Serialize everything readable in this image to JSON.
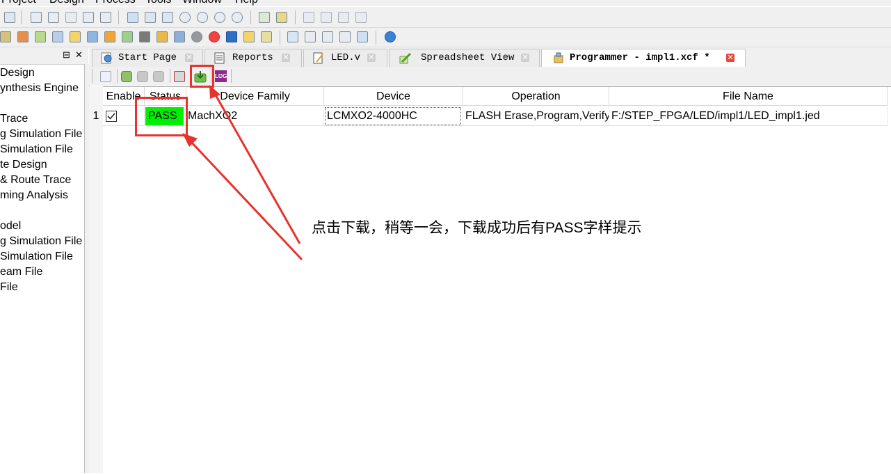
{
  "menubar": {
    "items": [
      "Project",
      "Design",
      "Process",
      "Tools",
      "Window",
      "Help"
    ]
  },
  "left_panel": {
    "items": [
      "Design",
      "ynthesis Engine",
      "Trace",
      "g Simulation File",
      "Simulation File",
      "te Design",
      "& Route Trace",
      "ming Analysis",
      "odel",
      "g Simulation File",
      "Simulation File",
      "eam File",
      "File"
    ],
    "pin_glyph": "⊟",
    "close_glyph": "✕"
  },
  "tabs": [
    {
      "label": "Start Page",
      "icon": "globe-page-icon",
      "active": false
    },
    {
      "label": "Reports",
      "icon": "report-icon",
      "active": false
    },
    {
      "label": "LED.v",
      "icon": "edit-document-icon",
      "active": false
    },
    {
      "label": "Spreadsheet View",
      "icon": "spreadsheet-pencil-icon",
      "active": false
    },
    {
      "label": "Programmer - impl1.xcf *",
      "icon": "programmer-chip-icon",
      "active": true
    }
  ],
  "tab_close_glyph": "✕",
  "programmer_toolbar": {
    "log_label": "LOG",
    "program_icon": "program-download-icon"
  },
  "table": {
    "columns": [
      "Enable",
      "Status",
      "Device Family",
      "Device",
      "Operation",
      "File Name"
    ],
    "rows": [
      {
        "index": "1",
        "enable_checked": true,
        "status": "PASS",
        "device_family": "MachXO2",
        "device": "LCMXO2-4000HC",
        "operation": "FLASH Erase,Program,Verify",
        "file_name": "F:/STEP_FPGA/LED/impl1/LED_impl1.jed"
      }
    ]
  },
  "annotation": {
    "text": "点击下载，稍等一会，下载成功后有PASS字样提示",
    "color": "#e8322e"
  },
  "colors": {
    "pass_green": "#00ee00",
    "annotation_red": "#e8322e"
  }
}
